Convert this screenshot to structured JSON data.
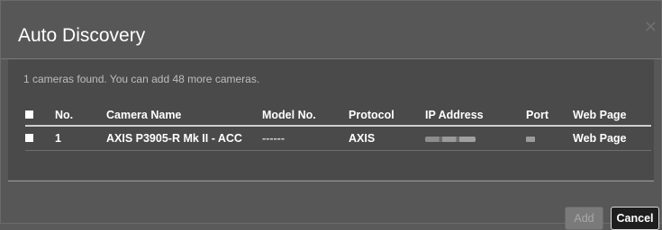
{
  "dialog": {
    "title": "Auto Discovery",
    "close_icon": "close-icon"
  },
  "status": {
    "message": "1 cameras found. You can add 48 more cameras."
  },
  "table": {
    "headers": {
      "no": "No.",
      "camera_name": "Camera Name",
      "model_no": "Model No.",
      "protocol": "Protocol",
      "ip_address": "IP Address",
      "port": "Port",
      "web_page": "Web Page"
    },
    "rows": [
      {
        "no": "1",
        "camera_name": "AXIS P3905-R Mk II - ACC",
        "model_no": "------",
        "protocol": "AXIS",
        "web_page": "Web Page"
      }
    ]
  },
  "buttons": {
    "add": "Add",
    "cancel": "Cancel"
  },
  "colors": {
    "dialog_bg": "#575757",
    "body_bg": "#4a4a4a",
    "cancel_bg": "#1e1e1e"
  }
}
